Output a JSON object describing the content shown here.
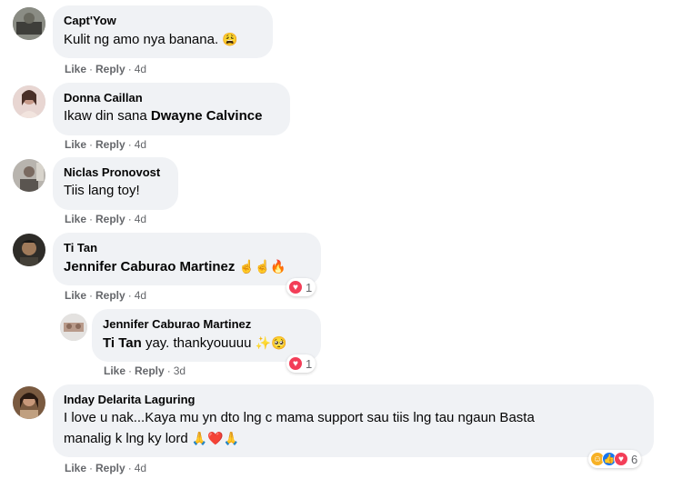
{
  "actions": {
    "like": "Like",
    "reply": "Reply",
    "sep": "·"
  },
  "comments": [
    {
      "author": "Capt'Yow",
      "text": "Kulit ng amo nya banana.",
      "emoji": "😩",
      "time": "4d"
    },
    {
      "author": "Donna Caillan",
      "text": "Ikaw din sana ",
      "tag": "Dwayne Calvince",
      "time": "4d"
    },
    {
      "author": "Niclas Pronovost",
      "text": "Tiis lang toy!",
      "time": "4d"
    },
    {
      "author": "Ti Tan",
      "tag": "Jennifer Caburao Martinez",
      "emoji": "☝☝🔥",
      "time": "4d",
      "reaction_count": "1"
    },
    {
      "author": "Jennifer Caburao Martinez",
      "tag": "Ti Tan",
      "text": " yay. thankyouuuu ",
      "emoji": "✨🥺",
      "time": "3d",
      "reaction_count": "1"
    },
    {
      "author": "Inday Delarita Laguring",
      "text_line1": "I love u nak...Kaya mu yn dto lng c mama support sau tiis lng tau ngaun Basta",
      "text_line2": "manalig k lng ky lord ",
      "emoji": "🙏❤️🙏",
      "time": "4d",
      "reaction_count": "6"
    }
  ],
  "colors": {
    "bubble": "#f0f2f5",
    "meta": "#65676b",
    "love": "#f33e58",
    "like": "#1877f2",
    "haha": "#f7b125"
  }
}
